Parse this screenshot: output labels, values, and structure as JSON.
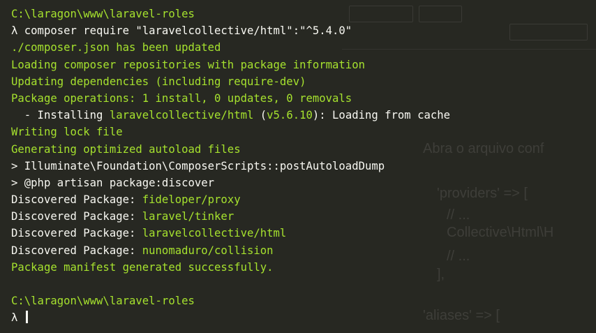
{
  "colors": {
    "background": "#272822",
    "text": "#f8f8f2",
    "green": "#a6e22e"
  },
  "terminal": {
    "lines": [
      {
        "parts": [
          {
            "text": "C:\\laragon\\www\\laravel-roles",
            "color": "green"
          }
        ]
      },
      {
        "parts": [
          {
            "text": "λ composer require \"laravelcollective/html\":\"^5.4.0\"",
            "color": "white"
          }
        ]
      },
      {
        "parts": [
          {
            "text": "./composer.json has been updated",
            "color": "green"
          }
        ]
      },
      {
        "parts": [
          {
            "text": "Loading composer repositories with package information",
            "color": "green"
          }
        ]
      },
      {
        "parts": [
          {
            "text": "Updating dependencies (including require-dev)",
            "color": "green"
          }
        ]
      },
      {
        "parts": [
          {
            "text": "Package operations: 1 install, 0 updates, 0 removals",
            "color": "green"
          }
        ]
      },
      {
        "parts": [
          {
            "text": "  - Installing ",
            "color": "white"
          },
          {
            "text": "laravelcollective/html",
            "color": "green"
          },
          {
            "text": " (",
            "color": "white"
          },
          {
            "text": "v5.6.10",
            "color": "green"
          },
          {
            "text": "): Loading from cache",
            "color": "white"
          }
        ]
      },
      {
        "parts": [
          {
            "text": "Writing lock file",
            "color": "green"
          }
        ]
      },
      {
        "parts": [
          {
            "text": "Generating optimized autoload files",
            "color": "green"
          }
        ]
      },
      {
        "parts": [
          {
            "text": "> Illuminate\\Foundation\\ComposerScripts::postAutoloadDump",
            "color": "white"
          }
        ]
      },
      {
        "parts": [
          {
            "text": "> @php artisan package:discover",
            "color": "white"
          }
        ]
      },
      {
        "parts": [
          {
            "text": "Discovered Package: ",
            "color": "white"
          },
          {
            "text": "fideloper/proxy",
            "color": "green"
          }
        ]
      },
      {
        "parts": [
          {
            "text": "Discovered Package: ",
            "color": "white"
          },
          {
            "text": "laravel/tinker",
            "color": "green"
          }
        ]
      },
      {
        "parts": [
          {
            "text": "Discovered Package: ",
            "color": "white"
          },
          {
            "text": "laravelcollective/html",
            "color": "green"
          }
        ]
      },
      {
        "parts": [
          {
            "text": "Discovered Package: ",
            "color": "white"
          },
          {
            "text": "nunomaduro/collision",
            "color": "green"
          }
        ]
      },
      {
        "parts": [
          {
            "text": "Package manifest generated successfully.",
            "color": "green"
          }
        ]
      },
      {
        "parts": [
          {
            "text": "",
            "color": "white"
          }
        ]
      },
      {
        "parts": [
          {
            "text": "C:\\laragon\\www\\laravel-roles",
            "color": "green"
          }
        ]
      },
      {
        "parts": [
          {
            "text": "λ ",
            "color": "white"
          }
        ],
        "cursor": true
      }
    ]
  },
  "background_doc": {
    "lines": [
      "Abra o arquivo conf",
      "'providers' => [",
      "// ...",
      "Collective\\Html\\H",
      "// ...",
      "],",
      "'aliases' => ["
    ]
  }
}
